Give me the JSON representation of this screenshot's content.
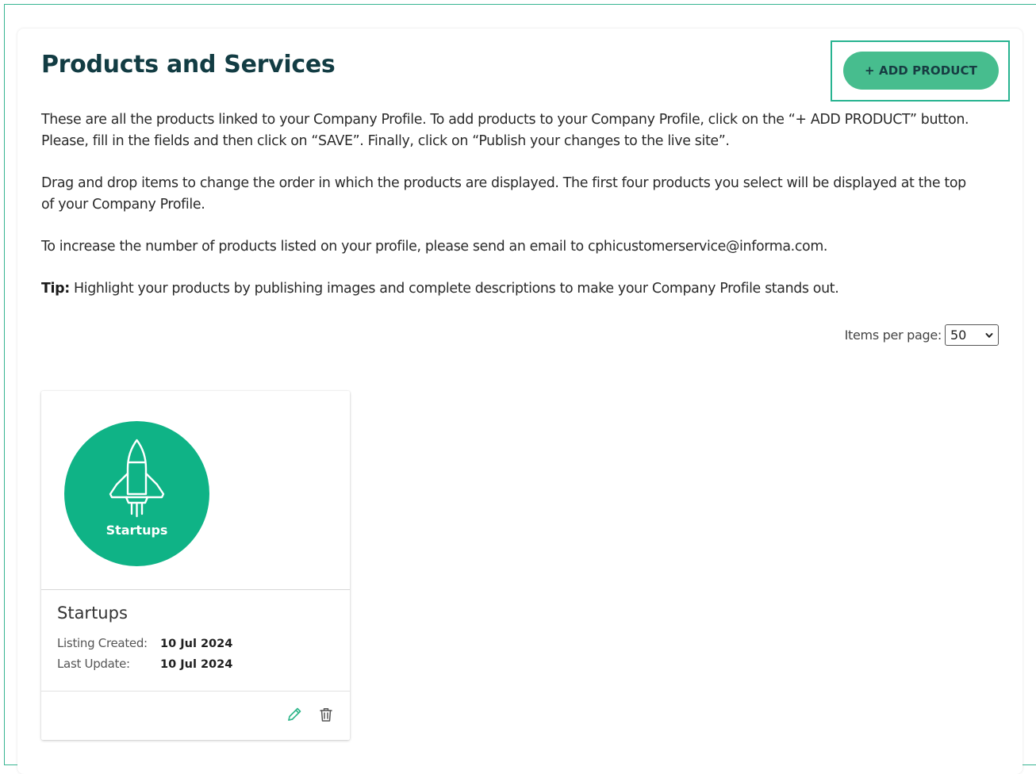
{
  "page": {
    "title": "Products and Services",
    "add_button_label": "+ ADD PRODUCT",
    "paragraphs": {
      "p1": "These are all the products linked to your Company Profile. To add products to your Company Profile, click on the “+ ADD PRODUCT” button. Please, fill in the fields and then click on “SAVE”. Finally, click on “Publish your changes to the live site”.",
      "p2": "Drag and drop items to change the order in which the products are displayed. The first four products you select will be displayed at the top of your Company Profile.",
      "p3": "To increase the number of products listed on your profile, please send an email to cphicustomerservice@informa.com.",
      "tip_label": "Tip:",
      "tip_text": " Highlight your products by publishing images and complete descriptions to make your Company Profile stands out."
    },
    "pagination": {
      "label": "Items per page:",
      "selected": "50"
    }
  },
  "products": [
    {
      "image_caption": "Startups",
      "name": "Startups",
      "created_label": "Listing Created:",
      "created_value": "10 Jul 2024",
      "updated_label": "Last Update:",
      "updated_value": "10 Jul 2024",
      "icons": [
        "rocket-icon",
        "pencil-icon",
        "trash-icon"
      ]
    }
  ],
  "colors": {
    "accent": "#47bd8e",
    "highlight_border": "#27b390",
    "logo_green": "#0fb386",
    "title": "#123c43"
  }
}
